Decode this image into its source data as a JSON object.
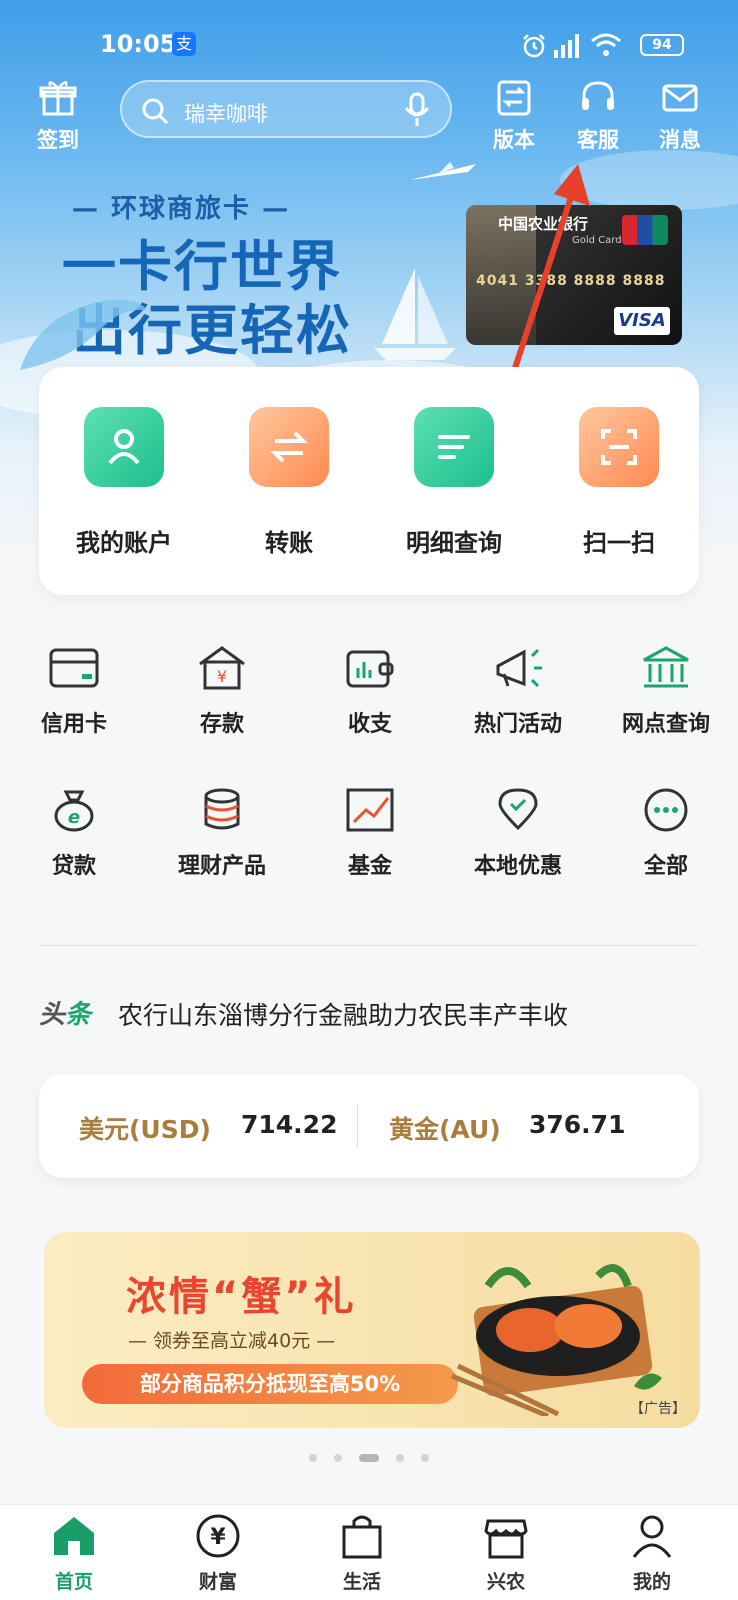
{
  "status_bar": {
    "time": "10:05",
    "battery": "94"
  },
  "header": {
    "checkin_label": "签到",
    "search_placeholder": "瑞幸咖啡",
    "version_label": "版本",
    "service_label": "客服",
    "message_label": "消息"
  },
  "banner": {
    "title": "— 环球商旅卡 —",
    "line1": "一卡行世界",
    "line2": "出行更轻松",
    "card_bank_name": "中国农业银行",
    "card_number": "4041 3388 8888 8888",
    "card_brand": "VISA",
    "card_type": "Gold Card"
  },
  "quick_actions": [
    {
      "label": "我的账户"
    },
    {
      "label": "转账"
    },
    {
      "label": "明细查询"
    },
    {
      "label": "扫一扫"
    }
  ],
  "services_row1": [
    {
      "label": "信用卡"
    },
    {
      "label": "存款"
    },
    {
      "label": "收支"
    },
    {
      "label": "热门活动"
    },
    {
      "label": "网点查询"
    }
  ],
  "services_row2": [
    {
      "label": "贷款"
    },
    {
      "label": "理财产品"
    },
    {
      "label": "基金"
    },
    {
      "label": "本地优惠"
    },
    {
      "label": "全部"
    }
  ],
  "news": {
    "tag_part1": "头",
    "tag_part2": "条",
    "text": "农行山东淄博分行金融助力农民丰产丰收"
  },
  "rates": {
    "usd_label": "美元(USD)",
    "usd_value": "714.22",
    "gold_label": "黄金(AU)",
    "gold_value": "376.71"
  },
  "ad": {
    "title": "浓情“蟹”礼",
    "subtitle": "— 领券至高立减40元 —",
    "pill": "部分商品积分抵现至高50%",
    "tag": "【广告】"
  },
  "carousel": {
    "count": 5,
    "active_index": 2
  },
  "tabbar": [
    {
      "label": "首页",
      "active": true
    },
    {
      "label": "财富",
      "active": false
    },
    {
      "label": "生活",
      "active": false
    },
    {
      "label": "兴农",
      "active": false
    },
    {
      "label": "我的",
      "active": false
    }
  ],
  "colors": {
    "brand_green": "#1a9d66",
    "sky_blue": "#3f9ee8",
    "annotation_red": "#e8412b"
  }
}
